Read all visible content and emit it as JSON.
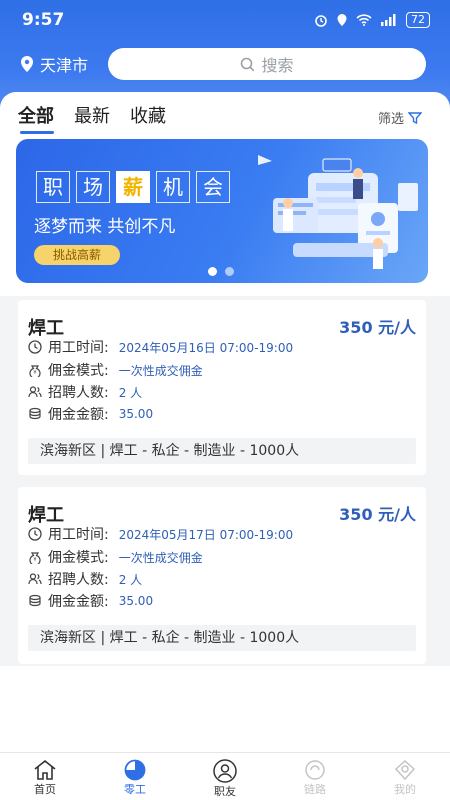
{
  "status": {
    "time": "9:57",
    "battery": "72"
  },
  "location": {
    "city": "天津市"
  },
  "search": {
    "placeholder": "搜索"
  },
  "tabs": [
    {
      "label": "全部"
    },
    {
      "label": "最新"
    },
    {
      "label": "收藏"
    }
  ],
  "filter": {
    "label": "筛选"
  },
  "banner": {
    "chars": [
      "职",
      "场",
      "薪",
      "机",
      "会"
    ],
    "subtitle": "逐梦而来 共创不凡",
    "button": "挑战高薪"
  },
  "jobs": [
    {
      "title": "焊工",
      "pay": "350 元/人",
      "time_label": "用工时间:",
      "time_value": "2024年05月16日 07:00-19:00",
      "mode_label": "佣金模式:",
      "mode_value": "一次性成交佣金",
      "count_label": "招聘人数:",
      "count_value": "2 人",
      "amount_label": "佣金金额:",
      "amount_value": "35.00",
      "tagline": "滨海新区 | 焊工 - 私企 - 制造业 - 1000人"
    },
    {
      "title": "焊工",
      "pay": "350 元/人",
      "time_label": "用工时间:",
      "time_value": "2024年05月17日 07:00-19:00",
      "mode_label": "佣金模式:",
      "mode_value": "一次性成交佣金",
      "count_label": "招聘人数:",
      "count_value": "2 人",
      "amount_label": "佣金金额:",
      "amount_value": "35.00",
      "tagline": "滨海新区 | 焊工 - 私企 - 制造业 - 1000人"
    }
  ],
  "nav": [
    {
      "label": "首页",
      "icon": "home-icon"
    },
    {
      "label": "零工",
      "icon": "pie-icon"
    },
    {
      "label": "职友",
      "icon": "person-icon"
    },
    {
      "label": "链路",
      "icon": "link-icon"
    },
    {
      "label": "我的",
      "icon": "user-icon"
    }
  ]
}
